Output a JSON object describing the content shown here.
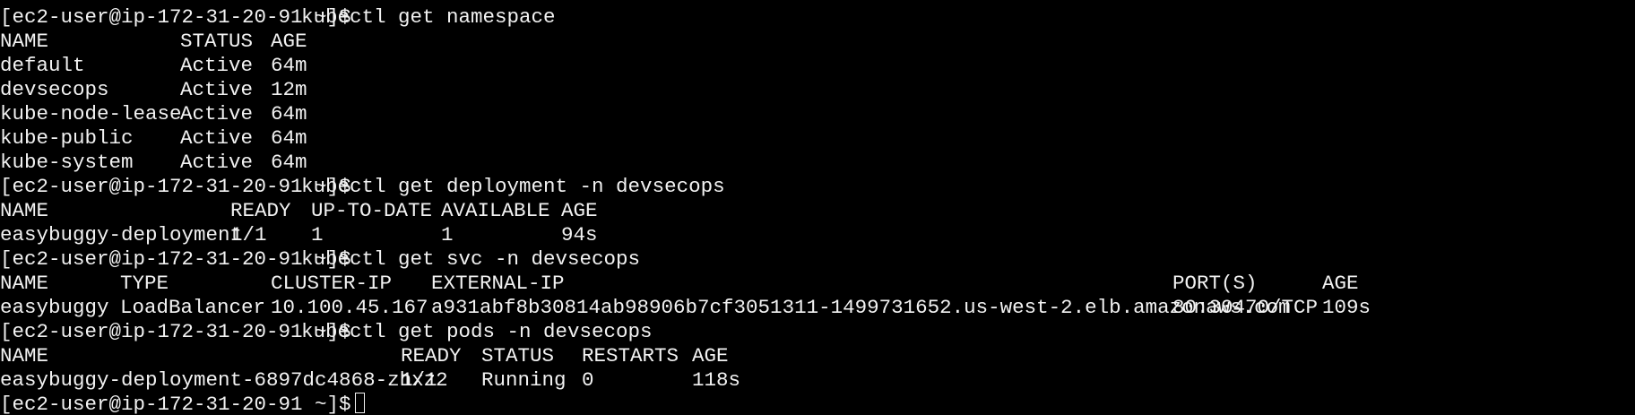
{
  "terminal": {
    "prompt": "[ec2-user@ip-172-31-20-91 ~]$",
    "commands": {
      "namespace": "kubectl get namespace",
      "deployment": "kubectl get deployment -n devsecops",
      "svc": "kubectl get svc -n devsecops",
      "pods": "kubectl get pods -n devsecops"
    },
    "namespaces": {
      "headers": [
        "NAME",
        "STATUS",
        "AGE"
      ],
      "rows": [
        [
          "default",
          "Active",
          "64m"
        ],
        [
          "devsecops",
          "Active",
          "12m"
        ],
        [
          "kube-node-lease",
          "Active",
          "64m"
        ],
        [
          "kube-public",
          "Active",
          "64m"
        ],
        [
          "kube-system",
          "Active",
          "64m"
        ]
      ]
    },
    "deployments": {
      "headers": [
        "NAME",
        "READY",
        "UP-TO-DATE",
        "AVAILABLE",
        "AGE"
      ],
      "rows": [
        [
          "easybuggy-deployment",
          "1/1",
          "1",
          "1",
          "94s"
        ]
      ]
    },
    "services": {
      "headers": [
        "NAME",
        "TYPE",
        "CLUSTER-IP",
        "EXTERNAL-IP",
        "PORT(S)",
        "AGE"
      ],
      "rows": [
        [
          "easybuggy",
          "LoadBalancer",
          "10.100.45.167",
          "a931abf8b30814ab98906b7cf3051311-1499731652.us-west-2.elb.amazonaws.com",
          "80:30470/TCP",
          "109s"
        ]
      ]
    },
    "pods": {
      "headers": [
        "NAME",
        "READY",
        "STATUS",
        "RESTARTS",
        "AGE"
      ],
      "rows": [
        [
          "easybuggy-deployment-6897dc4868-zhxz2",
          "1/1",
          "Running",
          "0",
          "118s"
        ]
      ]
    }
  }
}
